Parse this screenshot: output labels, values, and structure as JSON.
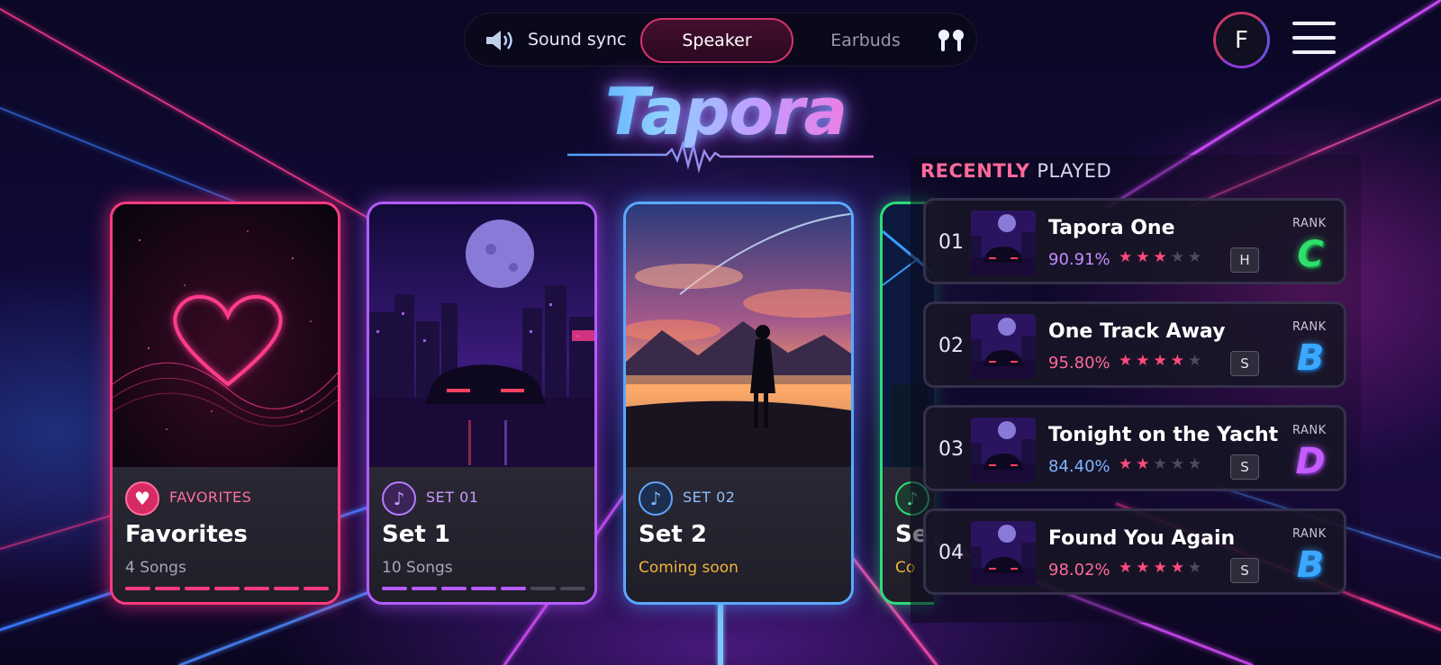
{
  "audio_toggle": {
    "sound_sync_label": "Sound sync",
    "options": [
      "Speaker",
      "Earbuds"
    ],
    "selected": "Speaker",
    "speaker_icon": "speaker-icon",
    "earbuds_icon": "earbuds-icon"
  },
  "profile": {
    "avatar_letter": "F",
    "menu_icon": "hamburger-menu-icon"
  },
  "logo": {
    "text": "Tapora"
  },
  "colors": {
    "favorites": "#ff3b7f",
    "set1": "#b45cff",
    "set2": "#5aa8ff",
    "set3": "#2ddc7a",
    "coming_soon": "#f0b43c",
    "star_on": "#ff4b7d"
  },
  "cards": [
    {
      "tag": "FAVORITES",
      "title": "Favorites",
      "subtitle": "4 Songs",
      "icon": "heart-icon",
      "progress": 1.0
    },
    {
      "tag": "SET 01",
      "title": "Set 1",
      "subtitle": "10 Songs",
      "icon": "music-note-icon",
      "progress": 0.71
    },
    {
      "tag": "SET 02",
      "title": "Set 2",
      "subtitle": "Coming soon",
      "icon": "music-note-icon"
    },
    {
      "tag": "",
      "title": "Se",
      "subtitle": "Co",
      "icon": "music-note-icon"
    }
  ],
  "recently_played": {
    "title_highlight": "RECENTLY",
    "title_rest": "PLAYED",
    "rank_label": "RANK",
    "items": [
      {
        "num": "01",
        "title": "Tapora One",
        "percent": "90.91%",
        "stars": 3,
        "difficulty": "H",
        "rank": "C",
        "percent_color": "#c48cff"
      },
      {
        "num": "02",
        "title": "One Track Away",
        "percent": "95.80%",
        "stars": 4,
        "difficulty": "S",
        "rank": "B",
        "percent_color": "#ff6a9a"
      },
      {
        "num": "03",
        "title": "Tonight on the Yacht",
        "percent": "84.40%",
        "stars": 2,
        "difficulty": "S",
        "rank": "D",
        "percent_color": "#7fb4ff"
      },
      {
        "num": "04",
        "title": "Found You Again",
        "percent": "98.02%",
        "stars": 4,
        "difficulty": "S",
        "rank": "B",
        "percent_color": "#ff6a9a"
      }
    ]
  }
}
